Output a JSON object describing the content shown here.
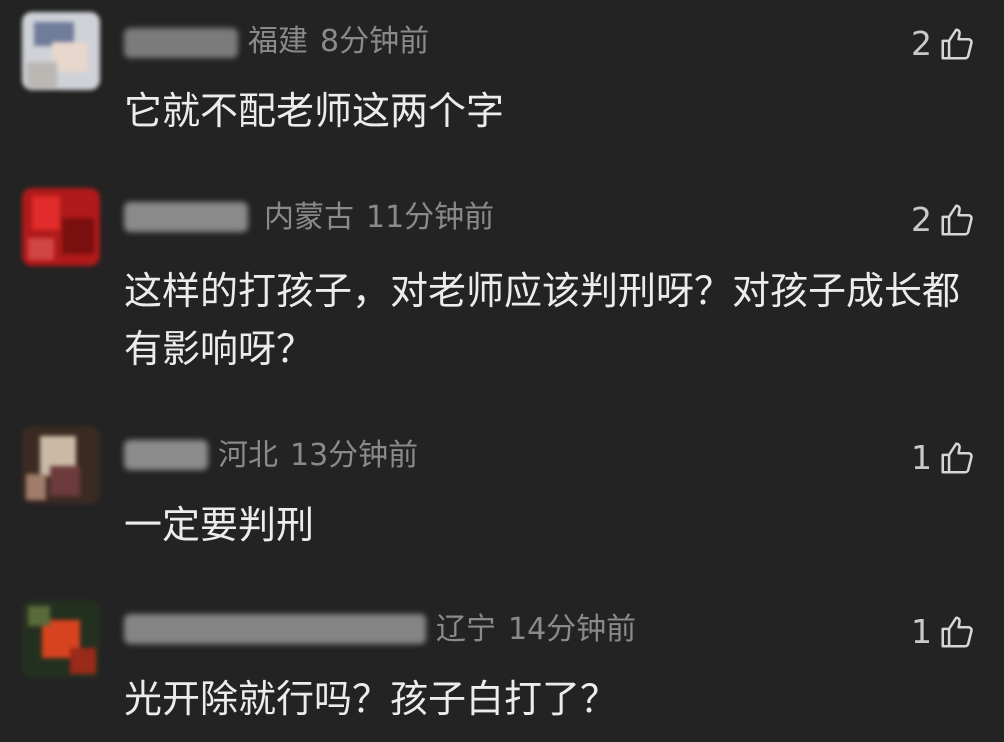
{
  "comments": [
    {
      "region": "福建",
      "time": "8分钟前",
      "likes": "2",
      "text": "它就不配老师这两个字"
    },
    {
      "region": "内蒙古",
      "time": "11分钟前",
      "likes": "2",
      "text": "这样的打孩子，对老师应该判刑呀？对孩子成长都有影响呀？"
    },
    {
      "region": "河北",
      "time": "13分钟前",
      "likes": "1",
      "text": "一定要判刑"
    },
    {
      "region": "辽宁",
      "time": "14分钟前",
      "likes": "1",
      "text": "光开除就行吗？孩子白打了？"
    }
  ],
  "icons": {
    "like": "thumbs-up-icon",
    "avatar": "blurred-avatar"
  },
  "colors": {
    "background": "#232323",
    "meta_text": "#8a8a8a",
    "body_text": "#ececec"
  }
}
